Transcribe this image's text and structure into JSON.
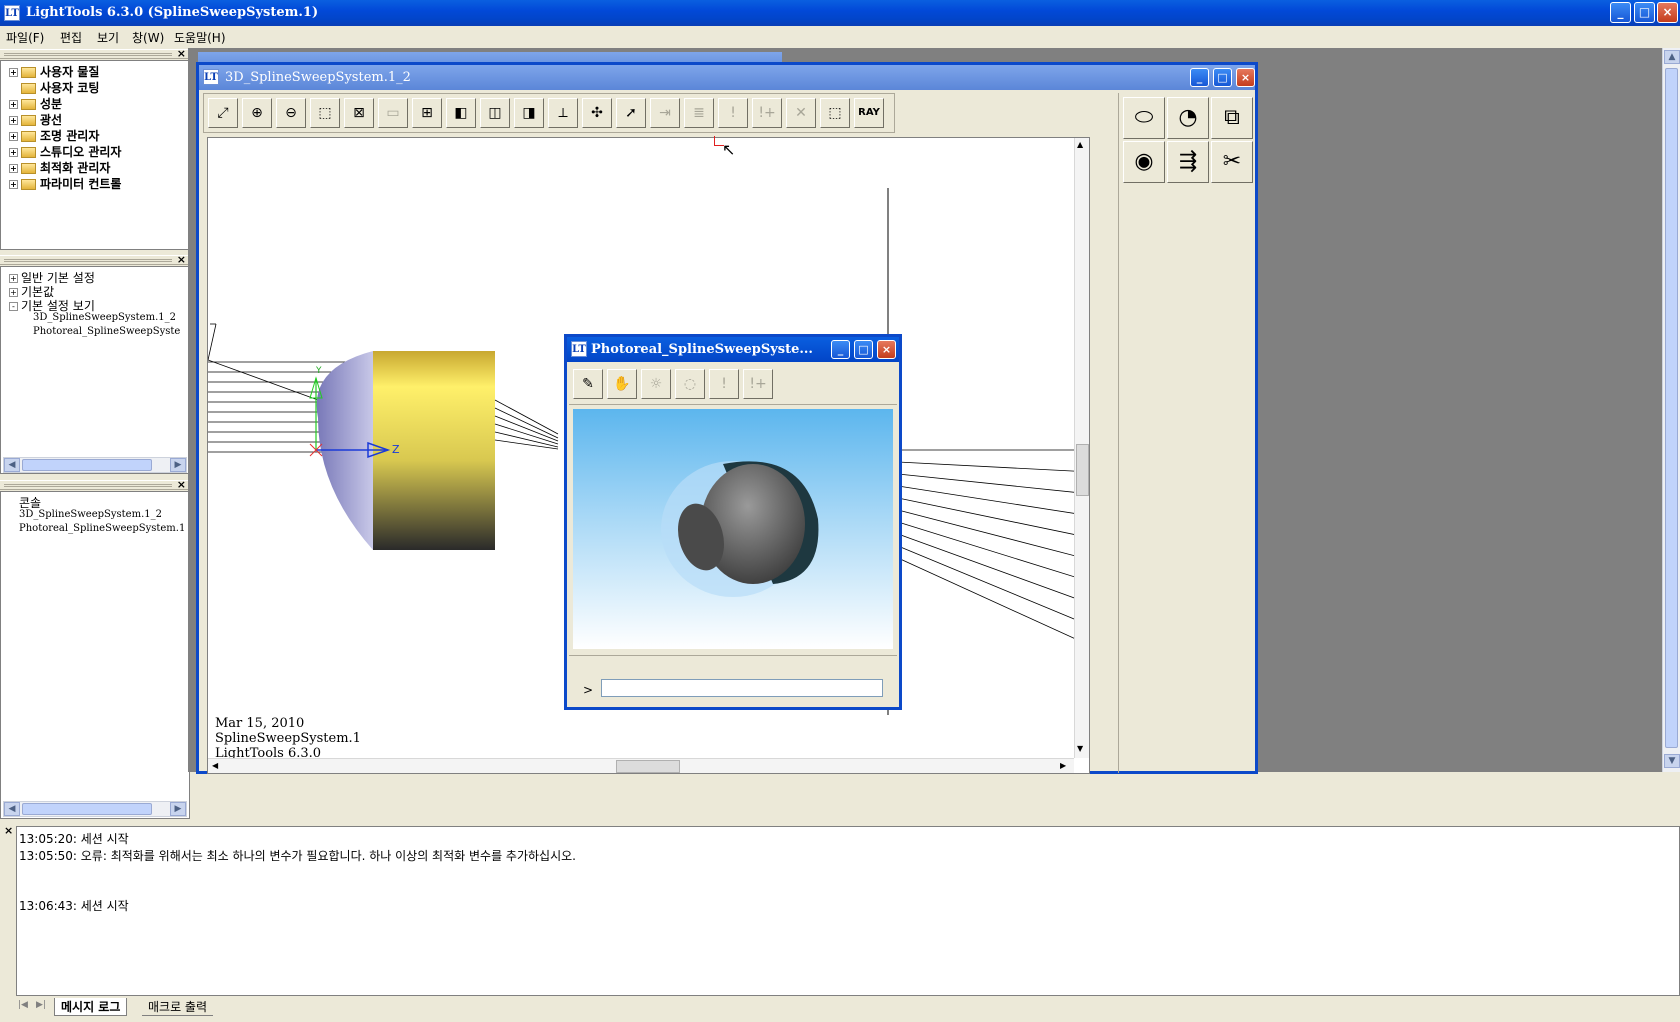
{
  "app": {
    "title": "LightTools 6.3.0  (SplineSweepSystem.1)",
    "icon_text": "LT"
  },
  "window_controls": {
    "minimize": "_",
    "maximize": "□",
    "close": "×"
  },
  "menu": [
    "파일(F)",
    "편집",
    "보기",
    "창(W)",
    "도움말(H)"
  ],
  "tree_panel": {
    "close_label": "×",
    "items": [
      "사용자 물질",
      "사용자 코팅",
      "성분",
      "광선",
      "조명 관리자",
      "스튜디오 관리자",
      "최적화 관리자",
      "파라미터 컨트롤"
    ]
  },
  "settings_panel": {
    "close_label": "×",
    "items": [
      "일반 기본 설정",
      "기본값",
      "기본 설정 보기"
    ],
    "subitems": [
      "3D_SplineSweepSystem.1_2",
      "Photoreal_SplineSweepSyste"
    ]
  },
  "console_panel": {
    "close_label": "×",
    "items": [
      "콘솔",
      "3D_SplineSweepSystem.1_2",
      "Photoreal_SplineSweepSystem.1"
    ]
  },
  "window_3d": {
    "title": "3D_SplineSweepSystem.1_2",
    "toolbar_icons": [
      "zoom-fit-icon",
      "zoom-in-icon",
      "zoom-out-icon",
      "zoom-window-icon",
      "zoom-all-icon",
      "single-view-icon",
      "quad-view-icon",
      "iso-view-icon",
      "front-view-icon",
      "side-view-icon",
      "axes-icon",
      "rotate-icon",
      "arrow-icon",
      "ray-trace-icon",
      "list-icon",
      "warning-icon",
      "warning-plus-icon",
      "delete-icon",
      "zoom-z-icon",
      "ray-icon"
    ],
    "ray_button_label": "RAY",
    "axis_label_y": "Y",
    "axis_label_z": "Z",
    "footer_date": "Mar 15, 2010",
    "footer_system": "SplineSweepSystem.1",
    "footer_version": "LightTools 6.3.0"
  },
  "side_palette": [
    "lens-icon",
    "receiver-icon",
    "solid-icon",
    "eye-icon",
    "lens-ray-icon",
    "scissors-icon"
  ],
  "photoreal_window": {
    "title": "Photoreal_SplineSweepSyste...",
    "toolbar_icons": [
      "brush-icon",
      "hand-icon",
      "light-icon",
      "light-disabled-icon",
      "light-minus-icon",
      "light-plus-icon"
    ],
    "prompt": ">"
  },
  "message_log": {
    "close_label": "×",
    "lines": [
      "13:05:20: 세션 시작",
      "13:05:50: 오류: 최적화를 위해서는 최소 하나의 변수가 필요합니다.  하나 이상의 최적화 변수를 추가하십시오.",
      "13:06:43: 세션 시작"
    ]
  },
  "tabs": [
    "메시지 로그",
    "매크로 출력"
  ],
  "colors": {
    "titlebar": "#0249d8",
    "face": "#ece9d8",
    "workspace": "#808080",
    "lens_yellow": "#e6d84c",
    "lens_purple": "#a8a8d8",
    "render_sky": "#6cc0f0"
  }
}
